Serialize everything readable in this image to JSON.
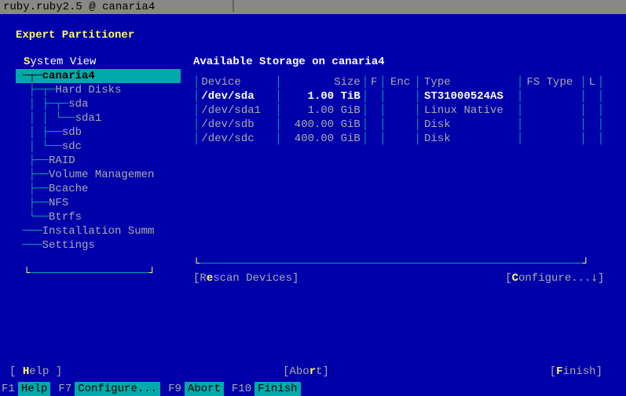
{
  "titlebar": "ruby.ruby2.5 @ canaria4",
  "header": "Expert Partitioner",
  "left": {
    "title_pre": "S",
    "title_rest": "ystem View",
    "items": [
      {
        "prefix": "─┬─",
        "label": "canaria4",
        "selected": true
      },
      {
        "prefix": " ├─┬─",
        "label": "Hard Disks"
      },
      {
        "prefix": " │ ├─┬─",
        "label": "sda"
      },
      {
        "prefix": " │ │ └──",
        "label": "sda1"
      },
      {
        "prefix": " │ ├──",
        "label": "sdb"
      },
      {
        "prefix": " │ └──",
        "label": "sdc"
      },
      {
        "prefix": " ├──",
        "label": "RAID"
      },
      {
        "prefix": " ├──",
        "label": "Volume Managemen"
      },
      {
        "prefix": " ├──",
        "label": "Bcache"
      },
      {
        "prefix": " ├──",
        "label": "NFS"
      },
      {
        "prefix": " └──",
        "label": "Btrfs"
      },
      {
        "prefix": "───",
        "label": "Installation Summ"
      },
      {
        "prefix": "───",
        "label": "Settings"
      }
    ]
  },
  "right": {
    "title": "Available Storage on canaria4",
    "headers": {
      "device": "Device",
      "size": "Size",
      "f": "F",
      "enc": "Enc",
      "type": "Type",
      "fstype": "FS Type",
      "l": "L"
    },
    "rows": [
      {
        "device": "/dev/sda",
        "size": "1.00 TiB",
        "f": "",
        "enc": "",
        "type": "ST31000524AS",
        "fstype": "",
        "l": "",
        "selected": true
      },
      {
        "device": "/dev/sda1",
        "size": "1.00 GiB",
        "f": "",
        "enc": "",
        "type": "Linux Native",
        "fstype": "",
        "l": ""
      },
      {
        "device": "/dev/sdb",
        "size": "400.00 GiB",
        "f": "",
        "enc": "",
        "type": "Disk",
        "fstype": "",
        "l": ""
      },
      {
        "device": "/dev/sdc",
        "size": "400.00 GiB",
        "f": "",
        "enc": "",
        "type": "Disk",
        "fstype": "",
        "l": ""
      }
    ],
    "rescan_pre": "R",
    "rescan_hot": "e",
    "rescan_post": "scan Devices",
    "configure_pre": "",
    "configure_hot": "C",
    "configure_post": "onfigure...",
    "configure_arrow": "↓"
  },
  "footer": {
    "help_pre": "",
    "help_hot": "H",
    "help_post": "elp",
    "abort_pre": "Abo",
    "abort_hot": "r",
    "abort_post": "t",
    "finish_pre": "",
    "finish_hot": "F",
    "finish_post": "inish"
  },
  "fkeys": [
    {
      "key": "F1",
      "label": "Help"
    },
    {
      "key": "F7",
      "label": "Configure..."
    },
    {
      "key": "F9",
      "label": "Abort"
    },
    {
      "key": "F10",
      "label": "Finish"
    }
  ]
}
